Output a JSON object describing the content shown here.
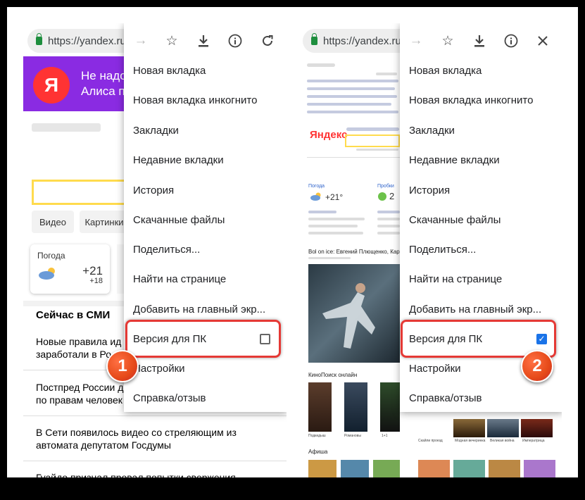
{
  "url": "https://yandex.ru",
  "left_page": {
    "logo": "Я",
    "banner_line1": "Не надо",
    "banner_line2": "Алиса п",
    "tab_video": "Видео",
    "tab_images": "Картинки",
    "weather_label": "Погода",
    "weather_temp": "+21",
    "weather_temp2": "+18",
    "news_heading": "Сейчас в СМИ",
    "news": [
      "Новые правила ид\nзаработали в Ро",
      "Постпред России д\nпо правам человек",
      "В Сети появилось видео со стреляющим из\nавтомата депутатом Госдумы",
      "Гуайдо признал провал попытки свержения"
    ]
  },
  "menu_left": {
    "items": [
      "Новая вкладка",
      "Новая вкладка инкогнито",
      "Закладки",
      "Недавние вкладки",
      "История",
      "Скачанные файлы",
      "Поделиться...",
      "Найти на странице",
      "Добавить на главный экр...",
      "Версия для ПК",
      "Настройки",
      "Справка/отзыв"
    ],
    "desktop_checked": false,
    "badge": "1"
  },
  "right_page": {
    "logo": "Яндекс",
    "weather_label": "Погода",
    "weather_temp": "+21°",
    "traffic_label": "Пробки",
    "traffic_val": "2",
    "news_title": "Bol on ice: Евгений Плющенко, Кар",
    "kinopoisk": "КиноПоиск онлайн",
    "afisha": "Афиша",
    "movies": [
      "Подкидыш",
      "Романовы",
      "1+1",
      "Скайли проезд",
      "Модная вечеринка",
      "Великая война",
      "Императрица"
    ]
  },
  "menu_right": {
    "items": [
      "Новая вкладка",
      "Новая вкладка инкогнито",
      "Закладки",
      "Недавние вкладки",
      "История",
      "Скачанные файлы",
      "Поделиться...",
      "Найти на странице",
      "Добавить на главный экр...",
      "Версия для ПК",
      "Настройки",
      "Справка/отзыв"
    ],
    "desktop_checked": true,
    "badge": "2"
  },
  "colors": {
    "accent_blue": "#1a73e8",
    "highlight_red": "#e53935",
    "badge_orange": "#e64a19",
    "banner_purple": "#8a2be2",
    "yandex_red": "#ff3333"
  }
}
